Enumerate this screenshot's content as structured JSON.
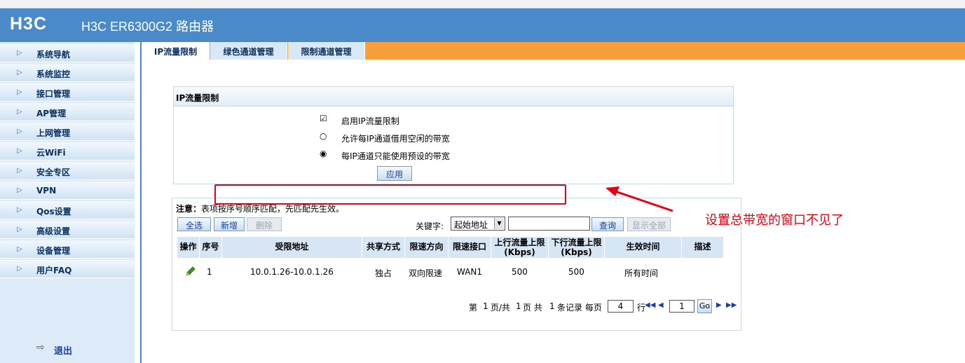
{
  "header": {
    "logo": "H3C",
    "model": "H3C ER6300G2 路由器",
    "header_color": "#4a8ac8"
  },
  "sidebar": {
    "items": [
      {
        "label": "系统导航"
      },
      {
        "label": "系统监控"
      },
      {
        "label": "接口管理"
      },
      {
        "label": "AP管理"
      },
      {
        "label": "上网管理"
      },
      {
        "label": "云WiFi"
      },
      {
        "label": "安全专区"
      },
      {
        "label": "VPN"
      },
      {
        "label": "Qos设置"
      },
      {
        "label": "高级设置"
      },
      {
        "label": "设备管理"
      },
      {
        "label": "用户FAQ"
      }
    ],
    "logout": "退出"
  },
  "tabs": [
    {
      "label": "IP流量限制",
      "active": true
    },
    {
      "label": "绿色通道管理",
      "active": false
    },
    {
      "label": "限制通道管理",
      "active": false
    }
  ],
  "settings": {
    "title": "IP流量限制",
    "options": [
      {
        "mark": "☑",
        "label": "启用IP流量限制",
        "state": "checked"
      },
      {
        "mark": "○",
        "label": "允许每IP通道借用空闲的带宽",
        "state": "unselected"
      },
      {
        "mark": "◉",
        "label": "每IP通道只能使用预设的带宽",
        "state": "selected"
      }
    ],
    "apply_label": "应用"
  },
  "list": {
    "note_prefix": "注意：",
    "note_text": "表项按序号顺序匹配，先匹配先生效。",
    "buttons": {
      "select_all": "全选",
      "add": "新增",
      "delete": "删除"
    },
    "keyword_label": "关键字:",
    "keyword_select": "起始地址",
    "search_label": "查询",
    "show_all_label": "显示全部",
    "columns": [
      "操作",
      "序号",
      "受限地址",
      "共享方式",
      "限速方向",
      "限速接口",
      "上行流量上限\n(Kbps)",
      "下行流量上限\n(Kbps)",
      "生效时间",
      "描述"
    ],
    "rows": [
      {
        "index": "1",
        "address": "10.0.1.26-10.0.1.26",
        "share": "独占",
        "direction": "双向限速",
        "interface": "WAN1",
        "up": "500",
        "down": "500",
        "time": "所有时间",
        "desc": ""
      }
    ],
    "pager": {
      "text1": "第",
      "page": "1",
      "text2": "页/共",
      "total_pages": "1",
      "text3": "页 共",
      "total_records": "1",
      "text4": "条记录 每页",
      "per_page": "4",
      "text5": "行",
      "goto_page": "1",
      "go_label": "Go"
    }
  },
  "annotation": {
    "text": "设置总带宽的窗口不见了",
    "color": "#e60012"
  }
}
